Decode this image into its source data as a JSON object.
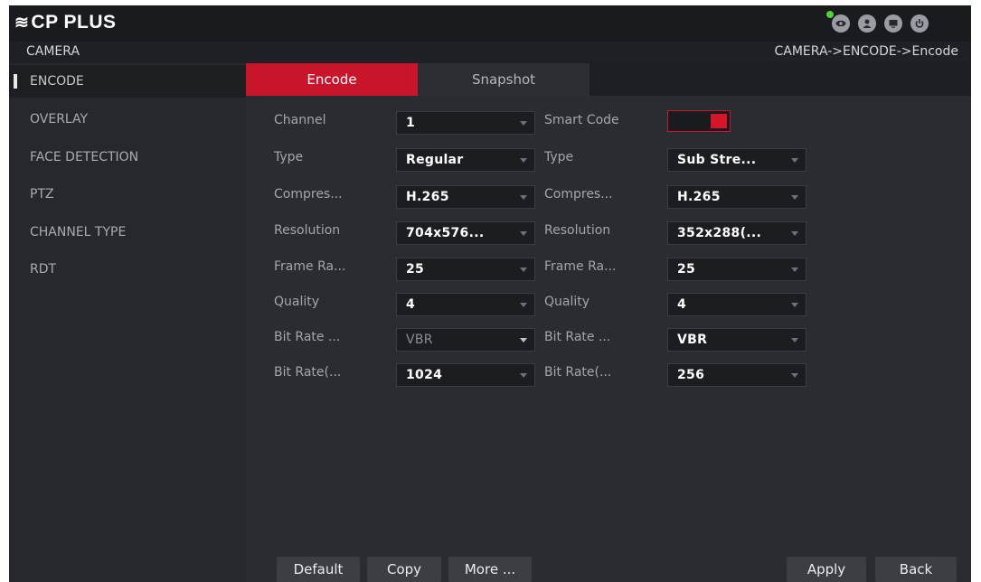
{
  "header": {
    "logo_mark": "≋",
    "logo_text": "CP PLUS",
    "icons": [
      "status-online-dot",
      "eye-icon",
      "user-icon",
      "screen-icon",
      "power-icon"
    ]
  },
  "subheader": {
    "section_title": "CAMERA",
    "breadcrumb": "CAMERA->ENCODE->Encode"
  },
  "sidebar": {
    "items": [
      {
        "label": "ENCODE",
        "active": true
      },
      {
        "label": "OVERLAY"
      },
      {
        "label": "FACE DETECTION"
      },
      {
        "label": "PTZ"
      },
      {
        "label": "CHANNEL TYPE"
      },
      {
        "label": "RDT"
      }
    ]
  },
  "tabs": [
    {
      "label": "Encode",
      "active": true
    },
    {
      "label": "Snapshot"
    }
  ],
  "main_stream": {
    "channel_label": "Channel",
    "channel_value": "1",
    "type_label": "Type",
    "type_value": "Regular",
    "compression_label": "Compres...",
    "compression_value": "H.265",
    "resolution_label": "Resolution",
    "resolution_value": "704x576...",
    "frame_rate_label": "Frame Ra...",
    "frame_rate_value": "25",
    "quality_label": "Quality",
    "quality_value": "4",
    "bitrate_type_label": "Bit Rate ...",
    "bitrate_type_value": "VBR",
    "bitrate_label": "Bit Rate(...",
    "bitrate_value": "1024"
  },
  "sub_stream": {
    "smart_code_label": "Smart Code",
    "smart_code_on": true,
    "type_label": "Type",
    "type_value": "Sub Stre...",
    "compression_label": "Compres...",
    "compression_value": "H.265",
    "resolution_label": "Resolution",
    "resolution_value": "352x288(...",
    "frame_rate_label": "Frame Ra...",
    "frame_rate_value": "25",
    "quality_label": "Quality",
    "quality_value": "4",
    "bitrate_type_label": "Bit Rate ...",
    "bitrate_type_value": "VBR",
    "bitrate_label": "Bit Rate(...",
    "bitrate_value": "256"
  },
  "buttons": {
    "default": "Default",
    "copy": "Copy",
    "more": "More ...",
    "apply": "Apply",
    "back": "Back"
  },
  "colors": {
    "accent": "#c8152b",
    "background": "#26282e",
    "header": "#1a1b1f",
    "status_online": "#4ed33a"
  }
}
